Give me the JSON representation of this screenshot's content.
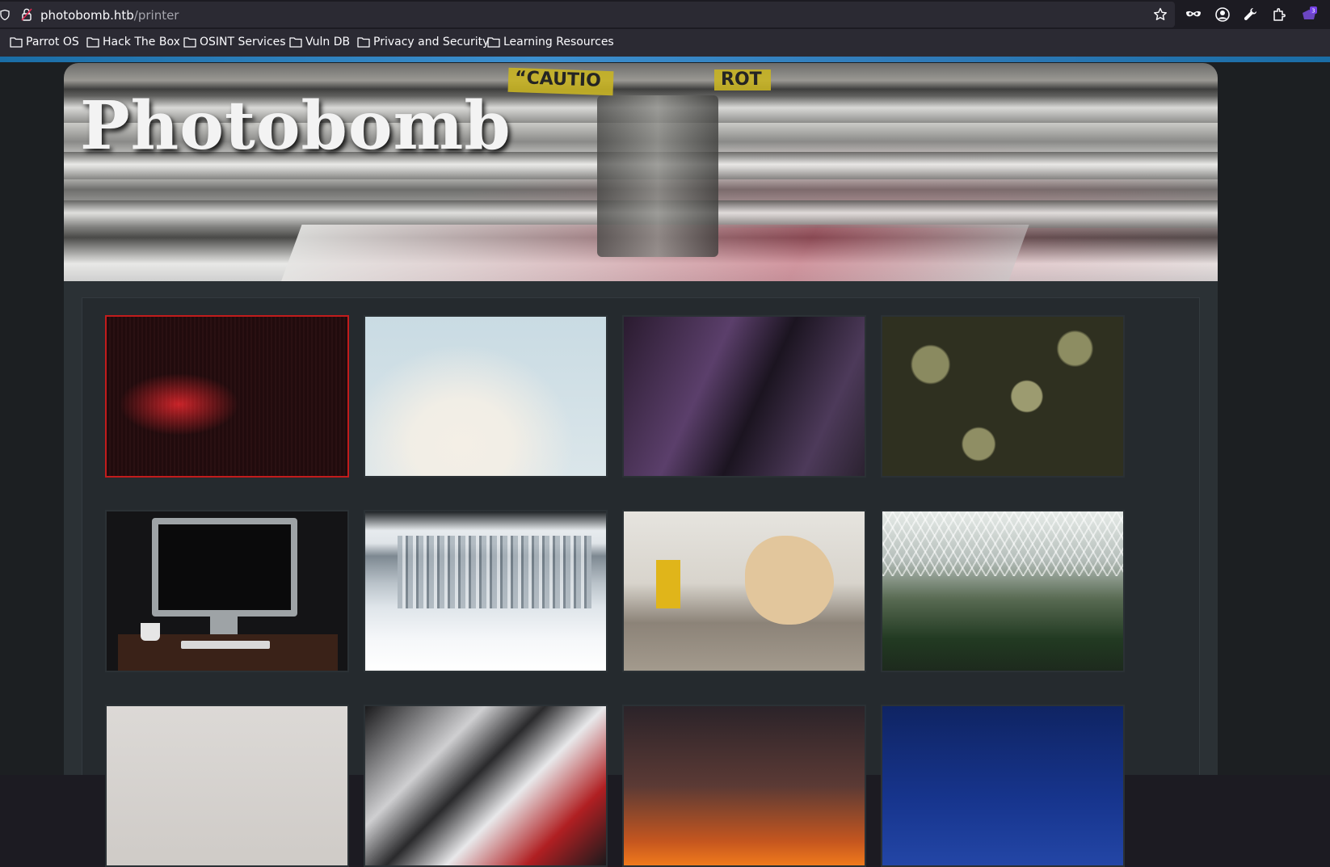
{
  "browser": {
    "url_host": "photobomb.htb",
    "url_path": "/printer",
    "extension_badge": "3",
    "bookmarks": [
      {
        "label": "Parrot OS"
      },
      {
        "label": "Hack The Box"
      },
      {
        "label": "OSINT Services"
      },
      {
        "label": "Vuln DB"
      },
      {
        "label": "Privacy and Security"
      },
      {
        "label": "Learning Resources"
      }
    ],
    "toolbar_icons": [
      "bookmark-star-icon",
      "mask-icon",
      "account-icon",
      "wrench-icon",
      "extensions-icon",
      "extension-badge-icon"
    ]
  },
  "page": {
    "title": "Photobomb",
    "header_signs": [
      "“CAUTIO",
      "ROT"
    ],
    "gallery": {
      "selected_index": 0,
      "images": [
        {
          "subject": "dark red lights"
        },
        {
          "subject": "white blossoms"
        },
        {
          "subject": "purple skyscrapers"
        },
        {
          "subject": "green succulents"
        },
        {
          "subject": "desktop computer"
        },
        {
          "subject": "frozen waterfall"
        },
        {
          "subject": "woodworking tools"
        },
        {
          "subject": "glass greenhouse"
        },
        {
          "subject": "plain light wall"
        },
        {
          "subject": "chrome shapes"
        },
        {
          "subject": "sunset sky"
        },
        {
          "subject": "blue sky"
        }
      ]
    }
  },
  "colors": {
    "selected_border": "#c21c1c",
    "progress_bar": "#2f7ab8",
    "page_bg": "#1c1f22",
    "gallery_bg": "#2b3135"
  }
}
